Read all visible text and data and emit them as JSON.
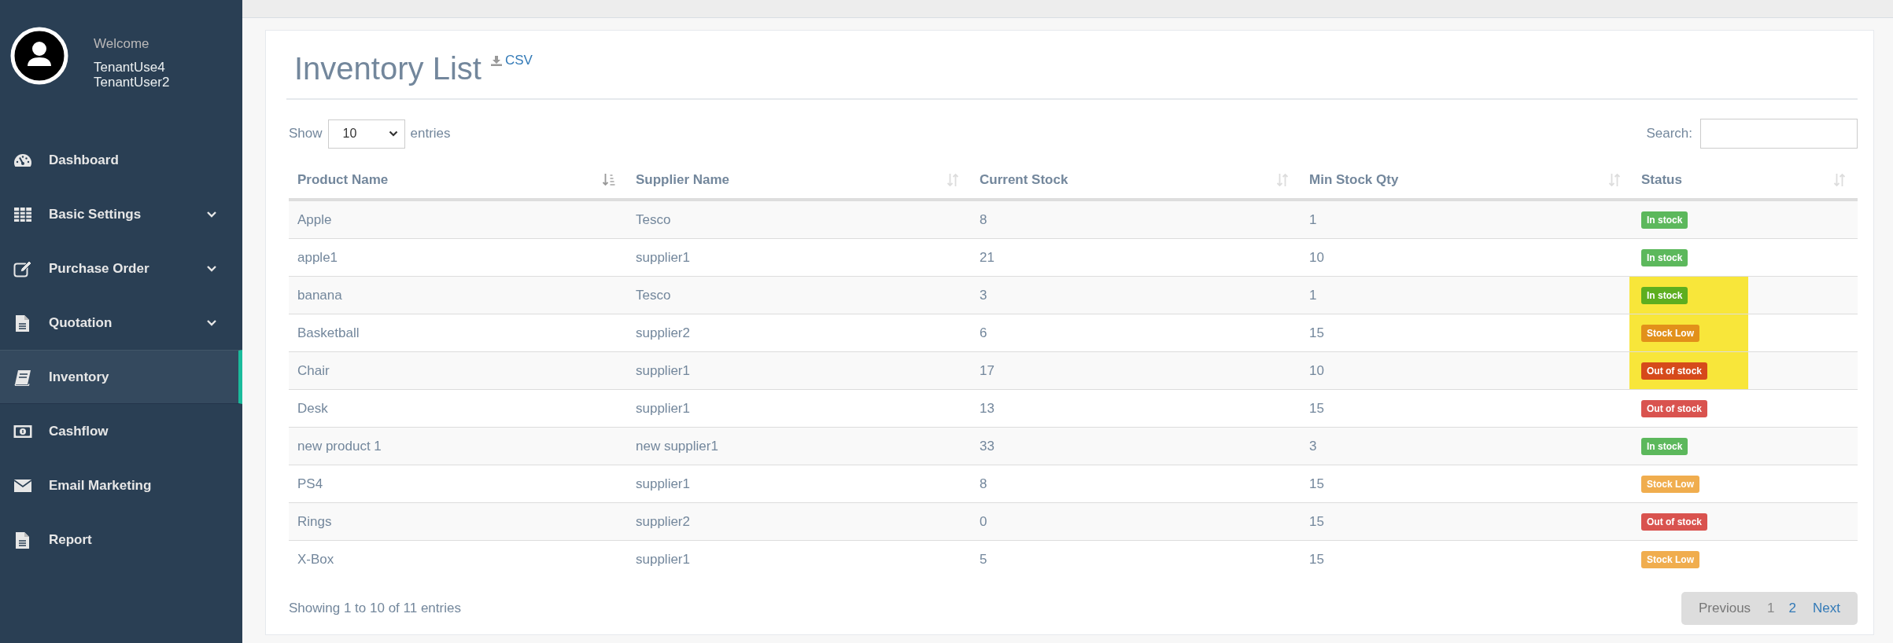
{
  "sidebar": {
    "welcome": "Welcome",
    "user_lines": [
      "TenantUse4",
      "TenantUser2"
    ],
    "items": [
      {
        "label": "Dashboard",
        "expandable": false,
        "selected": false
      },
      {
        "label": "Basic Settings",
        "expandable": true,
        "selected": false
      },
      {
        "label": "Purchase Order",
        "expandable": true,
        "selected": false
      },
      {
        "label": "Quotation",
        "expandable": true,
        "selected": false
      },
      {
        "label": "Inventory",
        "expandable": false,
        "selected": true
      },
      {
        "label": "Cashflow",
        "expandable": false,
        "selected": false
      },
      {
        "label": "Email Marketing",
        "expandable": false,
        "selected": false
      },
      {
        "label": "Report",
        "expandable": false,
        "selected": false
      }
    ]
  },
  "page": {
    "title": "Inventory List",
    "export_link": "CSV"
  },
  "table_controls": {
    "show_label": "Show",
    "page_size": "10",
    "entries_label": "entries",
    "search_label": "Search:"
  },
  "table": {
    "columns": [
      {
        "label": "Product Name",
        "sorted": true
      },
      {
        "label": "Supplier Name",
        "sorted": false
      },
      {
        "label": "Current Stock",
        "sorted": false
      },
      {
        "label": "Min Stock Qty",
        "sorted": false
      },
      {
        "label": "Status",
        "sorted": false
      }
    ],
    "rows": [
      {
        "cells": [
          "Apple",
          "Tesco",
          "8",
          "1"
        ],
        "status": "In stock",
        "color": "#5cb85c",
        "highlighted": false
      },
      {
        "cells": [
          "apple1",
          "supplier1",
          "21",
          "10"
        ],
        "status": "In stock",
        "color": "#5cb85c",
        "highlighted": false
      },
      {
        "cells": [
          "banana",
          "Tesco",
          "3",
          "1"
        ],
        "status": "In stock",
        "color": "#5dae1f",
        "highlighted": true
      },
      {
        "cells": [
          "Basketball",
          "supplier2",
          "6",
          "15"
        ],
        "status": "Stock Low",
        "color": "#e2901a",
        "highlighted": true
      },
      {
        "cells": [
          "Chair",
          "supplier1",
          "17",
          "10"
        ],
        "status": "Out of stock",
        "color": "#d64a1b",
        "highlighted": true
      },
      {
        "cells": [
          "Desk",
          "supplier1",
          "13",
          "15"
        ],
        "status": "Out of stock",
        "color": "#d9534f",
        "highlighted": false
      },
      {
        "cells": [
          "new product 1",
          "new supplier1",
          "33",
          "3"
        ],
        "status": "In stock",
        "color": "#5cb85c",
        "highlighted": false
      },
      {
        "cells": [
          "PS4",
          "supplier1",
          "8",
          "15"
        ],
        "status": "Stock Low",
        "color": "#f0ad4e",
        "highlighted": false
      },
      {
        "cells": [
          "Rings",
          "supplier2",
          "0",
          "15"
        ],
        "status": "Out of stock",
        "color": "#d9534f",
        "highlighted": false
      },
      {
        "cells": [
          "X-Box",
          "supplier1",
          "5",
          "15"
        ],
        "status": "Stock Low",
        "color": "#f0ad4e",
        "highlighted": false
      }
    ]
  },
  "footer": {
    "info": "Showing 1 to 10 of 11 entries",
    "pagination": [
      {
        "label": "Previous",
        "kind": "prev",
        "disabled": true,
        "selected": false
      },
      {
        "label": "1",
        "kind": "page",
        "disabled": false,
        "selected": true
      },
      {
        "label": "2",
        "kind": "page",
        "disabled": false,
        "selected": false
      },
      {
        "label": "Next",
        "kind": "next",
        "disabled": false,
        "selected": false
      }
    ]
  }
}
